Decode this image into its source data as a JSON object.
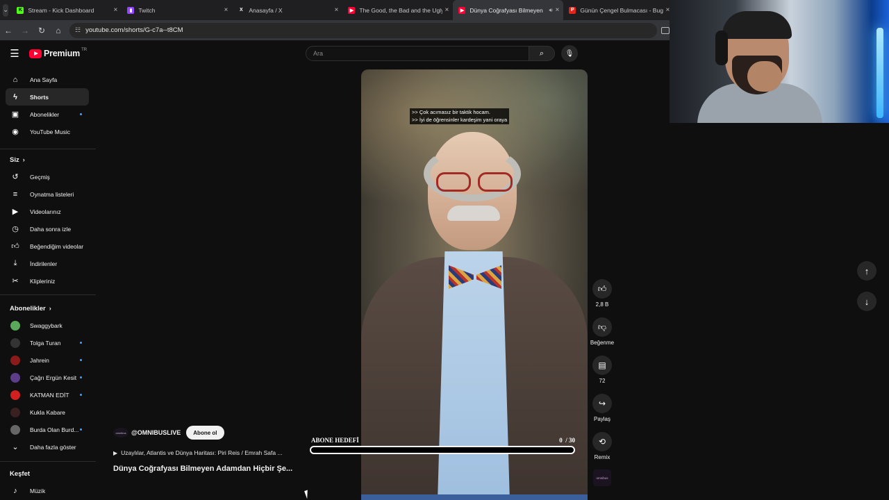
{
  "browser": {
    "tabs": [
      {
        "title": "Stream - Kick Dashboard",
        "favicon": "kick-icon",
        "color": "#53fc18"
      },
      {
        "title": "Twitch",
        "favicon": "twitch-icon",
        "color": "#9146ff"
      },
      {
        "title": "Anasayfa / X",
        "favicon": "x-icon",
        "color": "#ffffff"
      },
      {
        "title": "The Good, the Bad and the Ugly",
        "favicon": "youtube-icon",
        "color": "#ff0033"
      },
      {
        "title": "Dünya Coğrafyası Bilmeyen",
        "favicon": "youtube-icon",
        "color": "#ff0033",
        "active": true
      },
      {
        "title": "Günün Çengel Bulmacası - Bug",
        "favicon": "p-icon",
        "color": "#e2231a"
      }
    ],
    "url": "youtube.com/shorts/G-c7a--t8CM"
  },
  "youtube": {
    "logo_text": "Premium",
    "region": "TR",
    "search_placeholder": "Ara",
    "nav": [
      {
        "label": "Ana Sayfa",
        "icon": "home-icon"
      },
      {
        "label": "Shorts",
        "icon": "shorts-icon",
        "active": true
      },
      {
        "label": "Abonelikler",
        "icon": "subscriptions-icon",
        "dot": true
      },
      {
        "label": "YouTube Music",
        "icon": "youtube-music-icon"
      }
    ],
    "you_header": "Siz",
    "you_items": [
      {
        "label": "Geçmiş",
        "icon": "history-icon"
      },
      {
        "label": "Oynatma listeleri",
        "icon": "playlists-icon"
      },
      {
        "label": "Videolarınız",
        "icon": "your-videos-icon"
      },
      {
        "label": "Daha sonra izle",
        "icon": "watch-later-icon"
      },
      {
        "label": "Beğendiğim videolar",
        "icon": "liked-videos-icon"
      },
      {
        "label": "İndirilenler",
        "icon": "downloads-icon"
      },
      {
        "label": "Klipleriniz",
        "icon": "clips-icon"
      }
    ],
    "subs_header": "Abonelikler",
    "subscriptions": [
      {
        "label": "Swaggybark",
        "color": "#5aa85a",
        "dot": false
      },
      {
        "label": "Tolga Turan",
        "color": "#333333",
        "dot": true
      },
      {
        "label": "Jahrein",
        "color": "#8b1a1a",
        "dot": true
      },
      {
        "label": "Çağrı Ergün Kesit",
        "color": "#5b3d8a",
        "dot": true
      },
      {
        "label": "KATMAN EDİT",
        "color": "#d21f1f",
        "dot": true
      },
      {
        "label": "Kukla Kabare",
        "color": "#3a2020",
        "dot": false
      },
      {
        "label": "Burda Olan Burd...",
        "color": "#666666",
        "dot": true
      }
    ],
    "show_more": "Daha fazla göster",
    "explore_header": "Keşfet",
    "explore_items": [
      {
        "label": "Müzik",
        "icon": "music-icon"
      }
    ],
    "short": {
      "subtitle_line1": ">> Çok acımasız bir taktik hocam.",
      "subtitle_line2": ">> İyi de öğrensinler kardeşim yani oraya",
      "channel_handle": "@OMNIBUSLIVE",
      "channel_avatar_text": "omnibus",
      "subscribe_label": "Abone ol",
      "related_video": "Uzaylılar, Atlantis ve Dünya Haritası: Piri Reis / Emrah Safa ...",
      "title": "Dünya Coğrafyası Bilmeyen Adamdan Hiçbir Şe...",
      "likes": "2,8 B",
      "dislike_label": "Beğenme",
      "comments": "72",
      "share_label": "Paylaş",
      "remix_label": "Remix"
    },
    "overlay": {
      "goal_label": "ABONE HEDEFİ",
      "goal_current": "0",
      "goal_target": "/ 30",
      "goal_progress": 0.0
    }
  }
}
